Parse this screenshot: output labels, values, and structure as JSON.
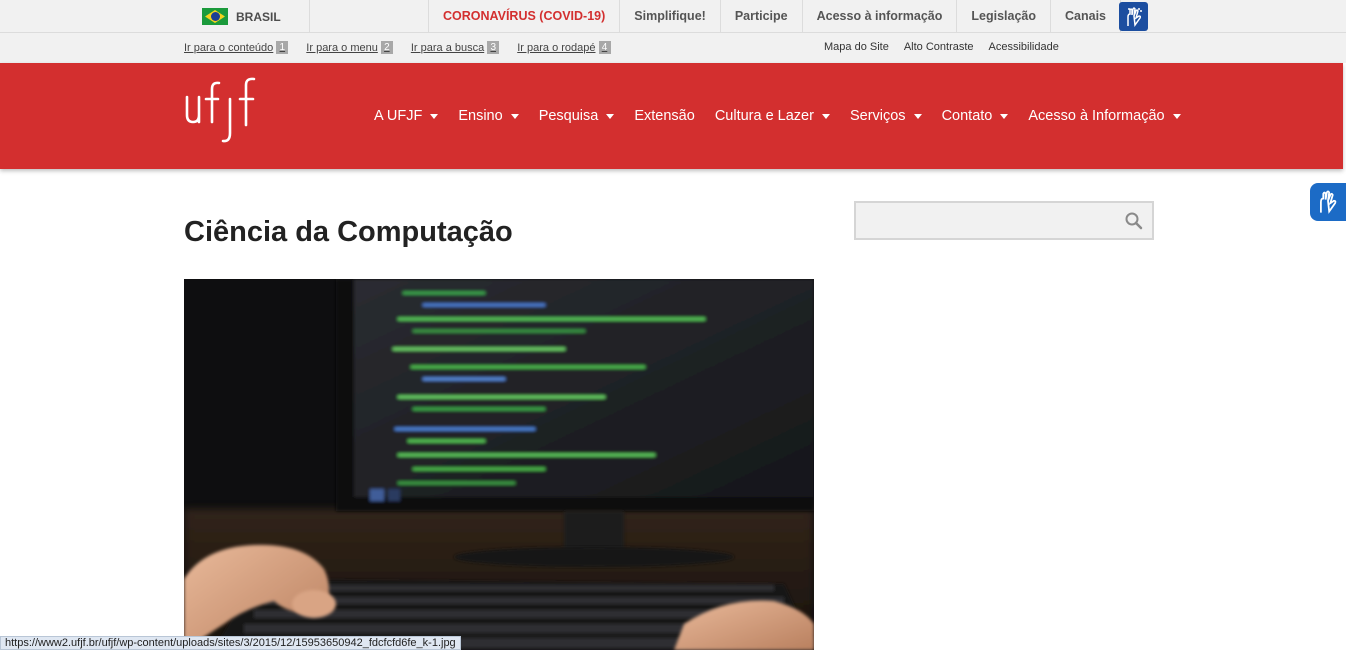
{
  "govbar": {
    "country": "BRASIL",
    "links": [
      {
        "label": "CORONAVÍRUS (COVID-19)",
        "highlight": true
      },
      {
        "label": "Simplifique!"
      },
      {
        "label": "Participe"
      },
      {
        "label": "Acesso à informação"
      },
      {
        "label": "Legislação"
      },
      {
        "label": "Canais"
      }
    ],
    "accessibility_icon": "sign-language-icon"
  },
  "accbar": {
    "shortcuts": [
      {
        "label": "Ir para o conteúdo",
        "key": "1"
      },
      {
        "label": "Ir para o menu",
        "key": "2"
      },
      {
        "label": "Ir para a busca",
        "key": "3"
      },
      {
        "label": "Ir para o rodapé",
        "key": "4"
      }
    ],
    "links": [
      "Mapa do Site",
      "Alto Contraste",
      "Acessibilidade"
    ]
  },
  "header": {
    "logo_text": "ufjf",
    "brand_color": "#d32f2f",
    "nav": [
      {
        "label": "A UFJF",
        "dropdown": true
      },
      {
        "label": "Ensino",
        "dropdown": true
      },
      {
        "label": "Pesquisa",
        "dropdown": true
      },
      {
        "label": "Extensão",
        "dropdown": false
      },
      {
        "label": "Cultura e Lazer",
        "dropdown": true
      },
      {
        "label": "Serviços",
        "dropdown": true
      },
      {
        "label": "Contato",
        "dropdown": true
      },
      {
        "label": "Acesso à Informação",
        "dropdown": true
      }
    ]
  },
  "main": {
    "title": "Ciência da Computação",
    "hero_image": "programmer typing code on keyboard in front of monitor"
  },
  "search": {
    "placeholder": "",
    "icon": "search-icon"
  },
  "statusbar": {
    "url": "https://www2.ufjf.br/ufjf/wp-content/uploads/sites/3/2015/12/15953650942_fdcfcfd6fe_k-1.jpg"
  }
}
